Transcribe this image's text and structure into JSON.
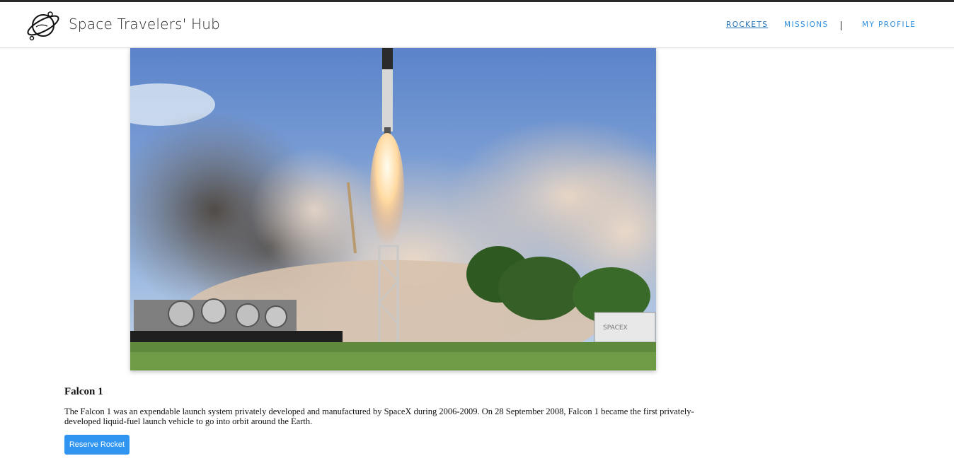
{
  "header": {
    "brand": "Space Travelers' Hub",
    "logo_icon": "planet-logo-icon",
    "nav": {
      "rockets": "ROCKETS",
      "missions": "MISSIONS",
      "profile": "MY PROFILE"
    },
    "active_nav": "rockets"
  },
  "rocket": {
    "name": "Falcon 1",
    "description": "The Falcon 1 was an expendable launch system privately developed and manufactured by SpaceX during 2006-2009. On 28 September 2008, Falcon 1 became the first privately-developed liquid-fuel launch vehicle to go into orbit around the Earth.",
    "reserve_label": "Reserve Rocket",
    "image_sign_text": "SPACEX"
  },
  "colors": {
    "accent": "#2f95f0",
    "nav_link": "#2d8fe0",
    "nav_active": "#1e6fb5"
  }
}
